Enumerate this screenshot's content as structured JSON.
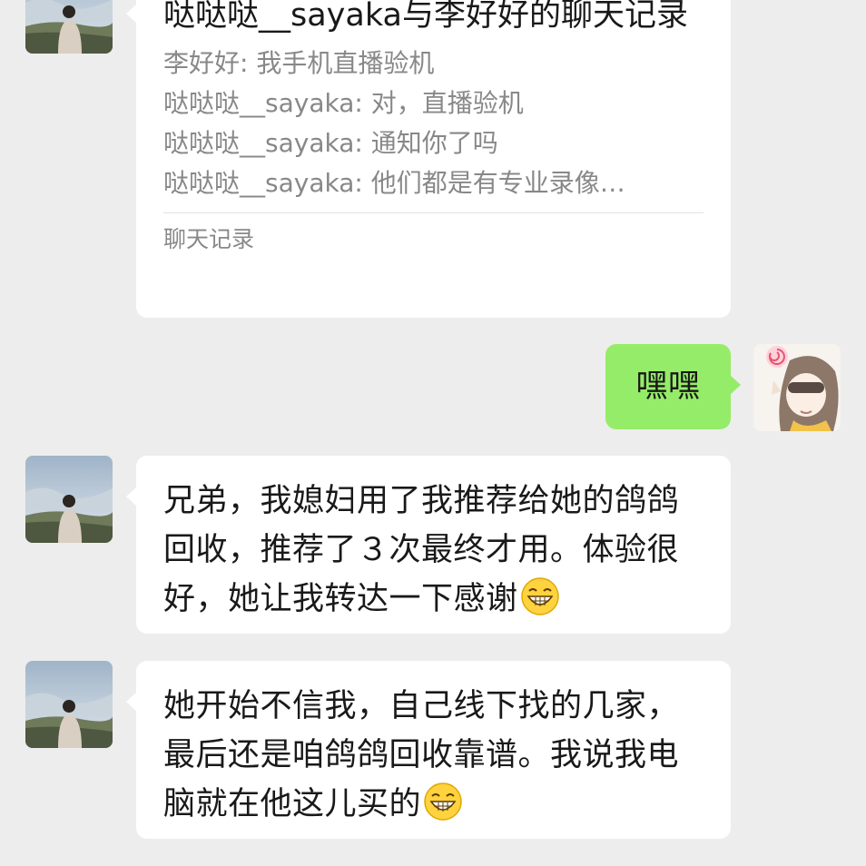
{
  "chat": {
    "record_card": {
      "title": "哒哒哒__sayaka与李好好的聊天记录",
      "lines": [
        "李好好: 我手机直播验机",
        "哒哒哒__sayaka: 对，直播验机",
        "哒哒哒__sayaka: 通知你了吗",
        "哒哒哒__sayaka: 他们都是有专业录像…"
      ],
      "footer": "聊天记录"
    },
    "my_message": "嘿嘿",
    "message_2": "兄弟，我媳妇用了我推荐给她的鸽鸽回收，推荐了３次最终才用。体验很好，她让我转达一下感谢",
    "message_3": "她开始不信我，自己线下找的几家，最后还是咱鸽鸽回收靠谱。我说我电脑就在他这儿买的",
    "emoji_name": "grin-emoji",
    "colors": {
      "background": "#ededed",
      "incoming_bubble": "#ffffff",
      "outgoing_bubble": "#95ec69"
    }
  }
}
